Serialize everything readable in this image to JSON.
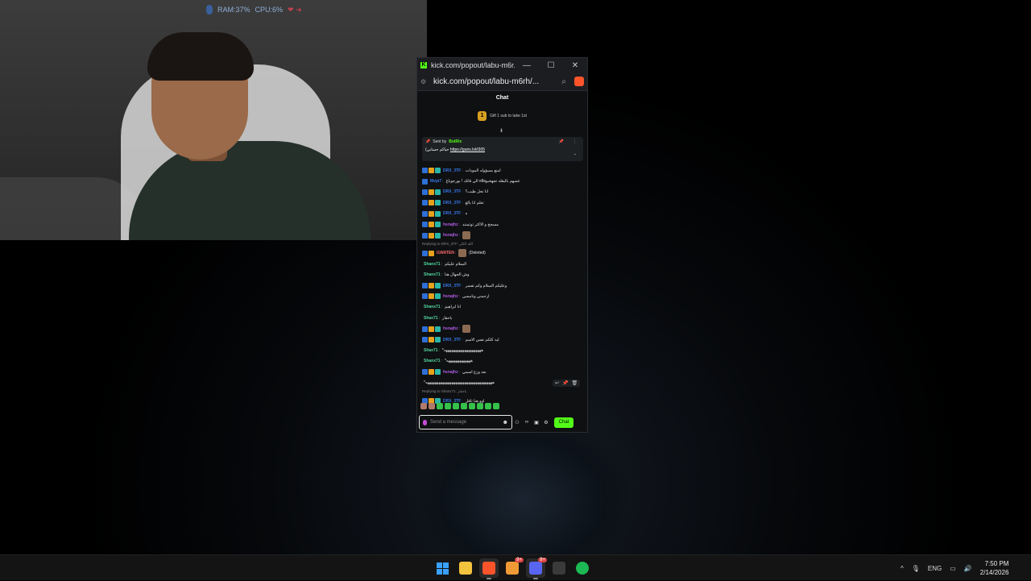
{
  "webcam": {
    "stats": {
      "ram": "RAM:37%",
      "cpu": "CPU:6%"
    }
  },
  "browser": {
    "title": "kick.com/popout/labu-m6r...",
    "url": "kick.com/popout/labu-m6rh/...",
    "window_controls": {
      "minimize": "—",
      "maximize": "☐",
      "close": "✕"
    }
  },
  "chat": {
    "header": "Chat",
    "gift_badge": "1",
    "gift_text": "Gift 1 sub to take 1st",
    "pinned": {
      "sent_by": "Sent by",
      "bot_name": "BotRix",
      "text_prefix": "(حياكم حسابي",
      "link": "https://guns.lol/i305"
    },
    "messages": [
      {
        "badges": 3,
        "user": "DRX_3TF",
        "user_color": "#3a78e8",
        "text": "امنع مسؤوله المودات"
      },
      {
        "badges": 1,
        "user": "Mvpi7",
        "user_color": "#3a78e8",
        "text": "الي فاتك ! بورجوباغ ellaعسهم بالبقله تجهخبو"
      },
      {
        "badges": 3,
        "user": "DRX_3TF",
        "user_color": "#3a78e8",
        "text": "انا نحل طيب؟"
      },
      {
        "badges": 3,
        "user": "DRX_3TF",
        "user_color": "#3a78e8",
        "text": "تعلم انا بالغ"
      },
      {
        "badges": 3,
        "user": "DRX_3TF",
        "user_color": "#3a78e8",
        "text": "ه"
      },
      {
        "badges": 3,
        "user": "hsnajhz",
        "user_color": "#b15ce6",
        "text": "مسجح و الاكثر توتمنند"
      },
      {
        "badges": 3,
        "user": "hsnajhz",
        "user_color": "#b15ce6",
        "text": "",
        "emote": true
      },
      {
        "reply": "Replying to DRX_3TF: الله الكثر"
      },
      {
        "badges": 2,
        "user": "I1WATEN",
        "user_color": "#ff6b6b",
        "text": "(Deleted)",
        "emote": true
      },
      {
        "badges": 0,
        "user": "Shanx71",
        "user_color": "#53d9a0",
        "text": "السلام عليكم"
      },
      {
        "badges": 0,
        "user": "Shanx71",
        "user_color": "#53d9a0",
        "text": "وش الجهال هنا"
      },
      {
        "badges": 3,
        "user": "DRX_3TF",
        "user_color": "#3a78e8",
        "text": "وعليكم السلام وكم تفسر"
      },
      {
        "badges": 3,
        "user": "hsnajhz",
        "user_color": "#b15ce6",
        "text": "ارحمني ونامسي"
      },
      {
        "badges": 0,
        "user": "Shanx71",
        "user_color": "#53d9a0",
        "text": "انا ابراهيم"
      },
      {
        "badges": 0,
        "user": "Shax71",
        "user_color": "#53d9a0",
        "text": "باحقار"
      },
      {
        "badges": 3,
        "user": "hsnajhz",
        "user_color": "#b15ce6",
        "text": "",
        "emote": true
      },
      {
        "badges": 3,
        "user": "DRX_3TF",
        "user_color": "#3a78e8",
        "text": "ليه كلكم نفس الاسم"
      },
      {
        "badges": 0,
        "user": "Shax71",
        "user_color": "#53d9a0",
        "text": "*ههههههههههههههههههههه"
      },
      {
        "badges": 0,
        "user": "Shanx71",
        "user_color": "#53d9a0",
        "text": "*هههههههههههههه"
      },
      {
        "badges": 3,
        "user": "hsnajhz",
        "user_color": "#b15ce6",
        "text": "بعد وزع اسمي"
      },
      {
        "badges": 0,
        "user": "",
        "user_color": "#fff",
        "text": "*ههههههههههههههههههههههههههههههههههههه"
      },
      {
        "reply": "Replying to Shanx71: باحقار"
      },
      {
        "badges": 3,
        "user": "DRX_3TF",
        "user_color": "#3a78e8",
        "text": "اوو هنا نافل"
      }
    ],
    "hover_actions": {
      "reply": "↩",
      "pin": "📌",
      "delete": "🗑"
    },
    "input_placeholder": "Send a message",
    "send_label": "Chat"
  },
  "taskbar": {
    "apps": [
      {
        "name": "windows-start",
        "color": "#3aa0ff"
      },
      {
        "name": "file-explorer",
        "color": "#f4c33d"
      },
      {
        "name": "brave-browser",
        "color": "#fb542b",
        "active": true
      },
      {
        "name": "chat-app",
        "color": "#f09a36",
        "badge": "9+"
      },
      {
        "name": "discord",
        "color": "#5865f2",
        "badge": "9+",
        "active": true
      },
      {
        "name": "obs-studio",
        "color": "#3a3a3a"
      },
      {
        "name": "spotify",
        "color": "#1db954"
      }
    ],
    "tray": {
      "chevron": "^",
      "language": "ENG",
      "time": "7:50 PM",
      "date": "2/14/2026"
    }
  }
}
